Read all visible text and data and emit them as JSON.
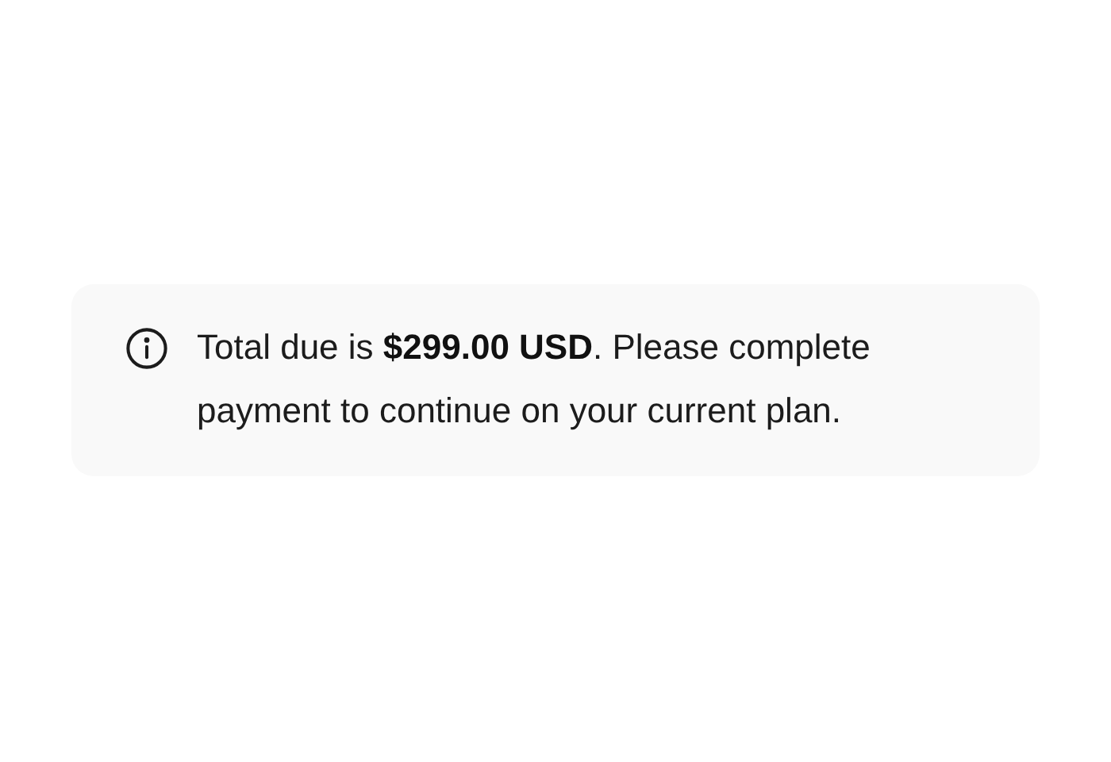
{
  "notice": {
    "text": "Total due is **$299.00 USD**. Please complete payment to continue on your current plan."
  }
}
